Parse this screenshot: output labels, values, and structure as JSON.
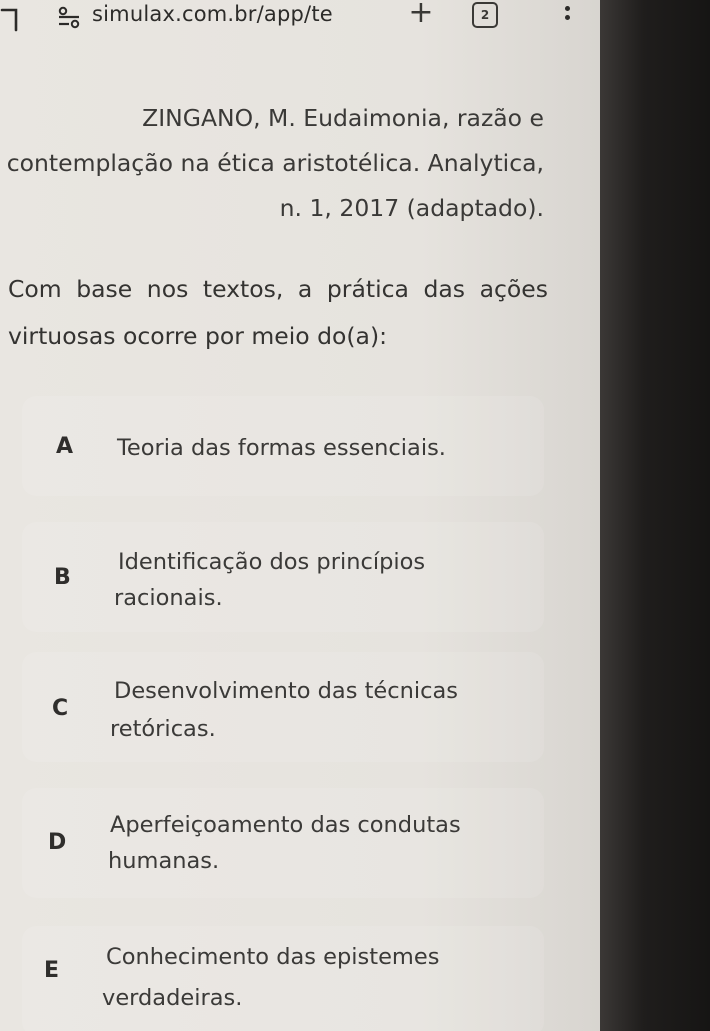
{
  "browser": {
    "url": "simulax.com.br/app/te",
    "new_tab_label": "+",
    "tab_count": "2"
  },
  "citation": {
    "line1": "ZINGANO, M. Eudaimonia, razão e",
    "line2": "contemplação na ética aristotélica. Analytica,",
    "line3": "n. 1, 2017 (adaptado)."
  },
  "question": {
    "text": "Com base nos textos, a prática das ações virtuosas ocorre por meio do(a):"
  },
  "options": [
    {
      "letter": "A",
      "line1": "Teoria das formas essenciais.",
      "line2": ""
    },
    {
      "letter": "B",
      "line1": "Identificação dos princípios",
      "line2": "racionais."
    },
    {
      "letter": "C",
      "line1": "Desenvolvimento das técnicas",
      "line2": "retóricas."
    },
    {
      "letter": "D",
      "line1": "Aperfeiçoamento das condutas",
      "line2": "humanas."
    },
    {
      "letter": "E",
      "line1": "Conhecimento das epistemes",
      "line2": "verdadeiras."
    }
  ],
  "icons": {
    "back": "back-arrow-icon",
    "site_info": "site-settings-icon",
    "menu": "more-vert-icon"
  },
  "colors": {
    "page_background": "#e8e5e0",
    "text": "#3a3937"
  }
}
